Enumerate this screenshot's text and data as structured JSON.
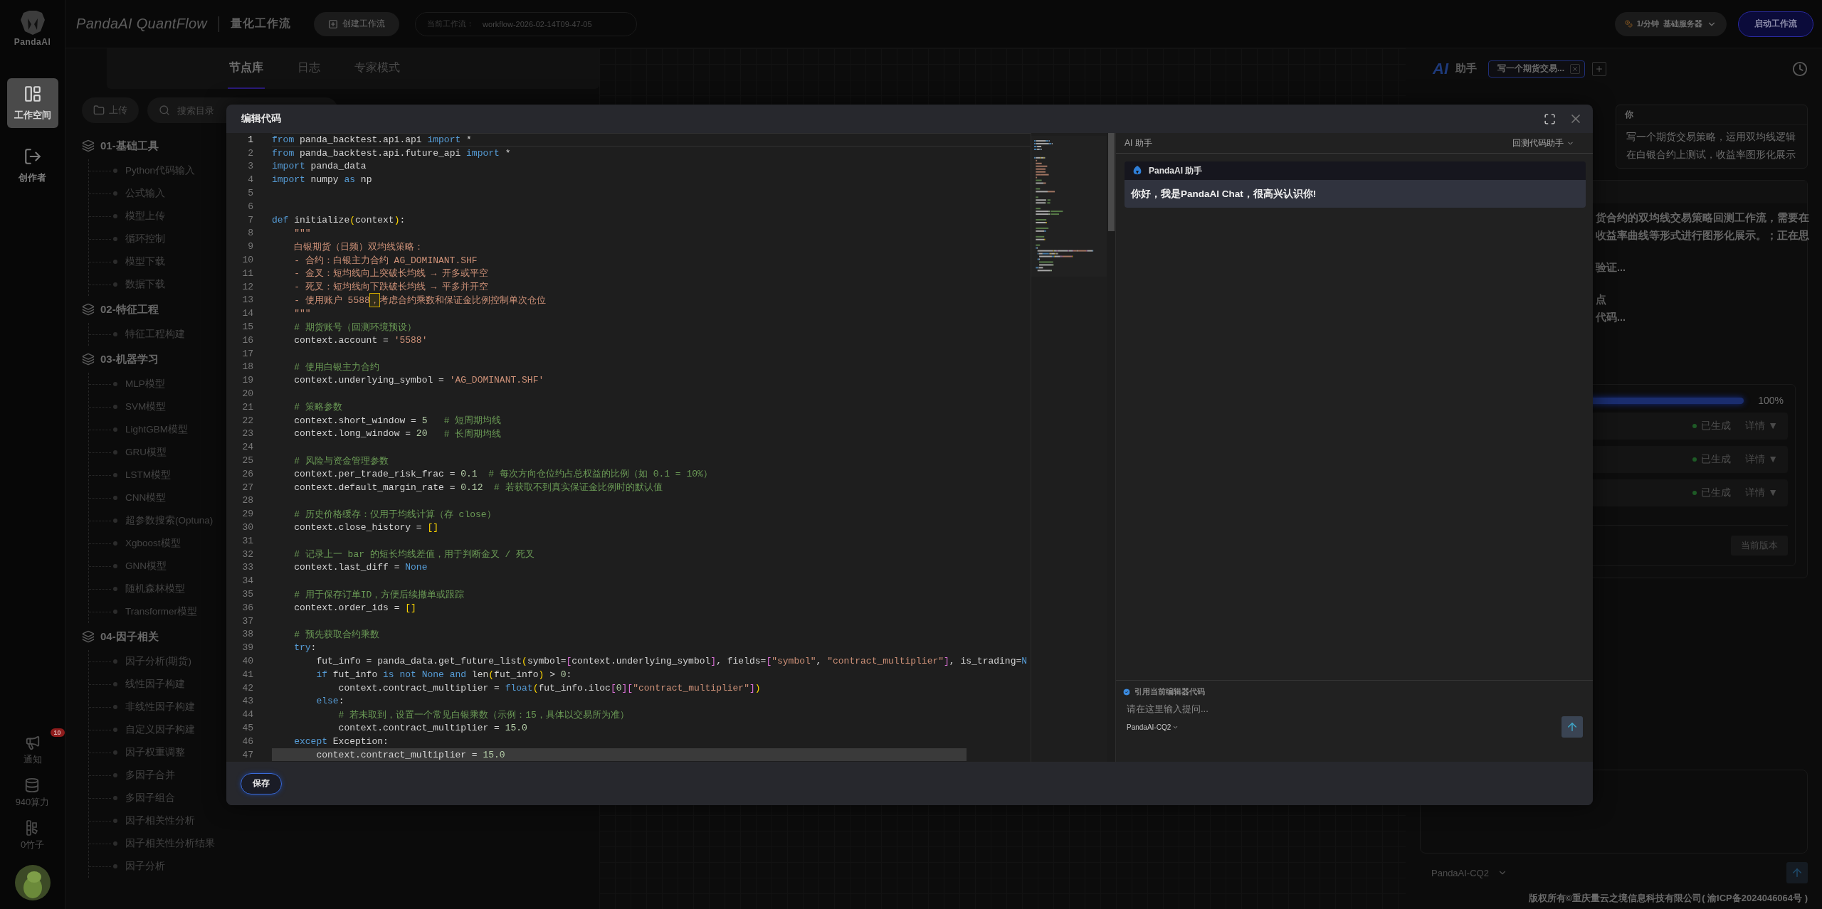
{
  "rail": {
    "logo_text": "PandaAI",
    "nav": [
      {
        "label": "工作空间",
        "selected": true
      },
      {
        "label": "创作者",
        "selected": false
      }
    ],
    "bottom": [
      {
        "kind": "notice",
        "label": "通知",
        "badge": "10"
      },
      {
        "kind": "compute",
        "label": "940算力"
      },
      {
        "kind": "bamboo",
        "label": "0竹子"
      }
    ]
  },
  "topbar": {
    "brand": "PandaAI QuantFlow",
    "subtitle": "量化工作流",
    "create_button": "创建工作流",
    "current_workflow": {
      "label": "当前工作流：",
      "value": "workflow-2026-02-14T09-47-05"
    },
    "server": {
      "rate": "1/分钟",
      "name": "基础服务器"
    },
    "start_button": "启动工作流"
  },
  "library": {
    "tabs": [
      {
        "label": "节点库",
        "selected": true
      },
      {
        "label": "日志",
        "selected": false
      },
      {
        "label": "专家模式",
        "selected": false
      }
    ],
    "upload": "上传",
    "search": {
      "placeholder": "搜索目录"
    },
    "groups": [
      {
        "label": "01-基础工具",
        "children": [
          "Python代码输入",
          "公式输入",
          "模型上传",
          "循环控制",
          "模型下载",
          "数据下载"
        ]
      },
      {
        "label": "02-特征工程",
        "children": [
          "特征工程构建"
        ]
      },
      {
        "label": "03-机器学习",
        "children": [
          "MLP模型",
          "SVM模型",
          "LightGBM模型",
          "GRU模型",
          "LSTM模型",
          "CNN模型",
          "超参数搜索(Optuna)",
          "Xgboost模型",
          "GNN模型",
          "随机森林模型",
          "Transformer模型"
        ]
      },
      {
        "label": "04-因子相关",
        "children": [
          "因子分析(期货)",
          "线性因子构建",
          "非线性因子构建",
          "自定义因子构建",
          "因子权重调整",
          "多因子合并",
          "多因子组合",
          "因子相关性分析",
          "因子相关性分析结果",
          "因子分析"
        ]
      }
    ]
  },
  "assistant": {
    "logo": "AI",
    "title": "助手",
    "chat_tab": "写一个期货交易...",
    "user": {
      "name": "你",
      "message": "写一个期货交易策略，运用双均线逻辑在白银合约上测试，收益率图形化展示"
    },
    "reply_paragraphs": [
      [
        "货合约的双均线交易策略回测工作流，需要在",
        "收益率曲线等形式进行图形化展示。；正在思"
      ],
      [
        "验证..."
      ],
      [
        "点",
        "代码..."
      ]
    ],
    "progress": {
      "level": 1,
      "reading": "100%"
    },
    "steps": [
      {
        "status": "已生成",
        "action": "详情 ▼"
      },
      {
        "status": "已生成",
        "action": "详情 ▼"
      },
      {
        "status": "已生成",
        "action": "详情 ▼"
      }
    ],
    "version_button": "当前版本",
    "model": "PandaAI-CQ2"
  },
  "footer": "版权所有©重庆量云之境信息科技有限公司( 渝ICP备2024046064号 )",
  "modal": {
    "title": "编辑代码",
    "save_button": "保存",
    "code": {
      "lines": [
        {
          "no": "1",
          "current": true,
          "selected": false,
          "spans": [
            {
              "kind": "k",
              "text": "from"
            },
            {
              "kind": "t",
              "text": " panda_backtest.api.api "
            },
            {
              "kind": "k",
              "text": "import"
            },
            {
              "kind": "t",
              "text": " *"
            }
          ]
        },
        {
          "no": "2",
          "current": false,
          "selected": false,
          "spans": [
            {
              "kind": "k",
              "text": "from"
            },
            {
              "kind": "t",
              "text": " panda_backtest.api.future_api "
            },
            {
              "kind": "k",
              "text": "import"
            },
            {
              "kind": "t",
              "text": " *"
            }
          ]
        },
        {
          "no": "3",
          "current": false,
          "selected": false,
          "spans": [
            {
              "kind": "k",
              "text": "import"
            },
            {
              "kind": "t",
              "text": " panda_data"
            }
          ]
        },
        {
          "no": "4",
          "current": false,
          "selected": false,
          "spans": [
            {
              "kind": "k",
              "text": "import"
            },
            {
              "kind": "t",
              "text": " numpy "
            },
            {
              "kind": "k",
              "text": "as"
            },
            {
              "kind": "t",
              "text": " np"
            }
          ]
        },
        {
          "no": "5",
          "current": false,
          "selected": false
        },
        {
          "no": "6",
          "current": false,
          "selected": false
        },
        {
          "no": "7",
          "current": false,
          "selected": false,
          "spans": [
            {
              "kind": "k",
              "text": "def"
            },
            {
              "kind": "t",
              "text": " initialize"
            },
            {
              "kind": "b",
              "text": "("
            },
            {
              "kind": "t",
              "text": "context"
            },
            {
              "kind": "b",
              "text": ")"
            },
            {
              "kind": "t",
              "text": ":"
            }
          ]
        },
        {
          "no": "8",
          "current": false,
          "selected": false,
          "spans": [
            {
              "kind": "s",
              "text": "    \"\"\""
            }
          ]
        },
        {
          "no": "9",
          "current": false,
          "selected": false,
          "spans": [
            {
              "kind": "s",
              "text": "    白银期货（日频）双均线策略："
            }
          ]
        },
        {
          "no": "10",
          "current": false,
          "selected": false,
          "spans": [
            {
              "kind": "s",
              "text": "    - 合约：白银主力合约 AG_DOMINANT.SHF"
            }
          ]
        },
        {
          "no": "11",
          "current": false,
          "selected": false,
          "spans": [
            {
              "kind": "s",
              "text": "    - 金叉：短均线向上突破长均线 → 开多或平空"
            }
          ]
        },
        {
          "no": "12",
          "current": false,
          "selected": false,
          "spans": [
            {
              "kind": "s",
              "text": "    - 死叉：短均线向下跌破长均线 → 平多并开空"
            }
          ]
        },
        {
          "no": "13",
          "current": false,
          "selected": false,
          "spans": [
            {
              "kind": "s",
              "text": "    - 使用账户 5588"
            },
            {
              "kind": "h",
              "text": "，"
            },
            {
              "kind": "s",
              "text": "考虑合约乘数和保证金比例控制单次仓位"
            }
          ]
        },
        {
          "no": "14",
          "current": false,
          "selected": false,
          "spans": [
            {
              "kind": "s",
              "text": "    \"\"\""
            }
          ]
        },
        {
          "no": "15",
          "current": false,
          "selected": false,
          "spans": [
            {
              "kind": "c",
              "text": "    # 期货账号（回测环境预设）"
            }
          ]
        },
        {
          "no": "16",
          "current": false,
          "selected": false,
          "spans": [
            {
              "kind": "t",
              "text": "    context.account = "
            },
            {
              "kind": "s",
              "text": "'5588'"
            }
          ]
        },
        {
          "no": "17",
          "current": false,
          "selected": false
        },
        {
          "no": "18",
          "current": false,
          "selected": false,
          "spans": [
            {
              "kind": "c",
              "text": "    # 使用白银主力合约"
            }
          ]
        },
        {
          "no": "19",
          "current": false,
          "selected": false,
          "spans": [
            {
              "kind": "t",
              "text": "    context.underlying_symbol = "
            },
            {
              "kind": "s",
              "text": "'AG_DOMINANT.SHF'"
            }
          ]
        },
        {
          "no": "20",
          "current": false,
          "selected": false
        },
        {
          "no": "21",
          "current": false,
          "selected": false,
          "spans": [
            {
              "kind": "c",
              "text": "    # 策略参数"
            }
          ]
        },
        {
          "no": "22",
          "current": false,
          "selected": false,
          "spans": [
            {
              "kind": "t",
              "text": "    context.short_window = "
            },
            {
              "kind": "n",
              "text": "5"
            },
            {
              "kind": "c",
              "text": "   # 短周期均线"
            }
          ]
        },
        {
          "no": "23",
          "current": false,
          "selected": false,
          "spans": [
            {
              "kind": "t",
              "text": "    context.long_window = "
            },
            {
              "kind": "n",
              "text": "20"
            },
            {
              "kind": "c",
              "text": "   # 长周期均线"
            }
          ]
        },
        {
          "no": "24",
          "current": false,
          "selected": false
        },
        {
          "no": "25",
          "current": false,
          "selected": false,
          "spans": [
            {
              "kind": "c",
              "text": "    # 风险与资金管理参数"
            }
          ]
        },
        {
          "no": "26",
          "current": false,
          "selected": false,
          "spans": [
            {
              "kind": "t",
              "text": "    context.per_trade_risk_frac = "
            },
            {
              "kind": "n",
              "text": "0.1"
            },
            {
              "kind": "c",
              "text": "  # 每次方向仓位约占总权益的比例（如 0.1 = 10%）"
            }
          ]
        },
        {
          "no": "27",
          "current": false,
          "selected": false,
          "spans": [
            {
              "kind": "t",
              "text": "    context.default_margin_rate = "
            },
            {
              "kind": "n",
              "text": "0.12"
            },
            {
              "kind": "c",
              "text": "  # 若获取不到真实保证金比例时的默认值"
            }
          ]
        },
        {
          "no": "28",
          "current": false,
          "selected": false
        },
        {
          "no": "29",
          "current": false,
          "selected": false,
          "spans": [
            {
              "kind": "c",
              "text": "    # 历史价格缓存：仅用于均线计算（存 close）"
            }
          ]
        },
        {
          "no": "30",
          "current": false,
          "selected": false,
          "spans": [
            {
              "kind": "t",
              "text": "    context.close_history = "
            },
            {
              "kind": "b",
              "text": "[]"
            }
          ]
        },
        {
          "no": "31",
          "current": false,
          "selected": false
        },
        {
          "no": "32",
          "current": false,
          "selected": false,
          "spans": [
            {
              "kind": "c",
              "text": "    # 记录上一 bar 的短长均线差值，用于判断金叉 / 死叉"
            }
          ]
        },
        {
          "no": "33",
          "current": false,
          "selected": false,
          "spans": [
            {
              "kind": "t",
              "text": "    context.last_diff = "
            },
            {
              "kind": "k",
              "text": "None"
            }
          ]
        },
        {
          "no": "34",
          "current": false,
          "selected": false
        },
        {
          "no": "35",
          "current": false,
          "selected": false,
          "spans": [
            {
              "kind": "c",
              "text": "    # 用于保存订单ID，方便后续撤单或跟踪"
            }
          ]
        },
        {
          "no": "36",
          "current": false,
          "selected": false,
          "spans": [
            {
              "kind": "t",
              "text": "    context.order_ids = "
            },
            {
              "kind": "b",
              "text": "[]"
            }
          ]
        },
        {
          "no": "37",
          "current": false,
          "selected": false
        },
        {
          "no": "38",
          "current": false,
          "selected": false,
          "spans": [
            {
              "kind": "c",
              "text": "    # 预先获取合约乘数"
            }
          ]
        },
        {
          "no": "39",
          "current": false,
          "selected": false,
          "spans": [
            {
              "kind": "k",
              "text": "    try"
            },
            {
              "kind": "t",
              "text": ":"
            }
          ]
        },
        {
          "no": "40",
          "current": false,
          "selected": false,
          "spans": [
            {
              "kind": "t",
              "text": "        fut_info = panda_data.get_future_list"
            },
            {
              "kind": "b",
              "text": "("
            },
            {
              "kind": "t",
              "text": "symbol="
            },
            {
              "kind": "p",
              "text": "["
            },
            {
              "kind": "t",
              "text": "context.underlying_symbol"
            },
            {
              "kind": "p",
              "text": "]"
            },
            {
              "kind": "t",
              "text": ", fields="
            },
            {
              "kind": "p",
              "text": "["
            },
            {
              "kind": "s",
              "text": "\"symbol\""
            },
            {
              "kind": "t",
              "text": ", "
            },
            {
              "kind": "s",
              "text": "\"contract_multiplier\""
            },
            {
              "kind": "p",
              "text": "]"
            },
            {
              "kind": "t",
              "text": ", is_trading="
            },
            {
              "kind": "k",
              "text": "N"
            }
          ]
        },
        {
          "no": "41",
          "current": false,
          "selected": false,
          "spans": [
            {
              "kind": "k",
              "text": "        if"
            },
            {
              "kind": "t",
              "text": " fut_info "
            },
            {
              "kind": "k",
              "text": "is not None and"
            },
            {
              "kind": "t",
              "text": " len"
            },
            {
              "kind": "b",
              "text": "("
            },
            {
              "kind": "t",
              "text": "fut_info"
            },
            {
              "kind": "b",
              "text": ")"
            },
            {
              "kind": "t",
              "text": " > "
            },
            {
              "kind": "n",
              "text": "0"
            },
            {
              "kind": "t",
              "text": ":"
            }
          ]
        },
        {
          "no": "42",
          "current": false,
          "selected": false,
          "spans": [
            {
              "kind": "t",
              "text": "            context.contract_multiplier = "
            },
            {
              "kind": "k",
              "text": "float"
            },
            {
              "kind": "b",
              "text": "("
            },
            {
              "kind": "t",
              "text": "fut_info.iloc"
            },
            {
              "kind": "p",
              "text": "["
            },
            {
              "kind": "n",
              "text": "0"
            },
            {
              "kind": "p",
              "text": "]["
            },
            {
              "kind": "s",
              "text": "\"contract_multiplier\""
            },
            {
              "kind": "p",
              "text": "]"
            },
            {
              "kind": "b",
              "text": ")"
            }
          ]
        },
        {
          "no": "43",
          "current": false,
          "selected": false,
          "spans": [
            {
              "kind": "k",
              "text": "        else"
            },
            {
              "kind": "t",
              "text": ":"
            }
          ]
        },
        {
          "no": "44",
          "current": false,
          "selected": false,
          "spans": [
            {
              "kind": "c",
              "text": "            # 若未取到，设置一个常见白银乘数（示例：15，具体以交易所为准）"
            }
          ]
        },
        {
          "no": "45",
          "current": false,
          "selected": false,
          "spans": [
            {
              "kind": "t",
              "text": "            context.contract_multiplier = "
            },
            {
              "kind": "n",
              "text": "15.0"
            }
          ]
        },
        {
          "no": "46",
          "current": false,
          "selected": false,
          "spans": [
            {
              "kind": "k",
              "text": "    except"
            },
            {
              "kind": "t",
              "text": " Exception:"
            }
          ]
        },
        {
          "no": "47",
          "current": false,
          "selected": true,
          "spans": [
            {
              "kind": "t",
              "text": "        context.contract_multiplier = "
            },
            {
              "kind": "n",
              "text": "15.0"
            }
          ]
        }
      ]
    },
    "chat": {
      "title": "AI 助手",
      "mode": "回测代码助手",
      "greeting": {
        "sender": "PandaAI 助手",
        "message": "你好，我是PandaAI Chat，很高兴认识你!"
      },
      "quote": {
        "label": "引用当前编辑器代码",
        "checked": true
      },
      "input": {
        "placeholder": "请在这里输入提问..."
      },
      "model": "PandaAI-CQ2"
    }
  }
}
